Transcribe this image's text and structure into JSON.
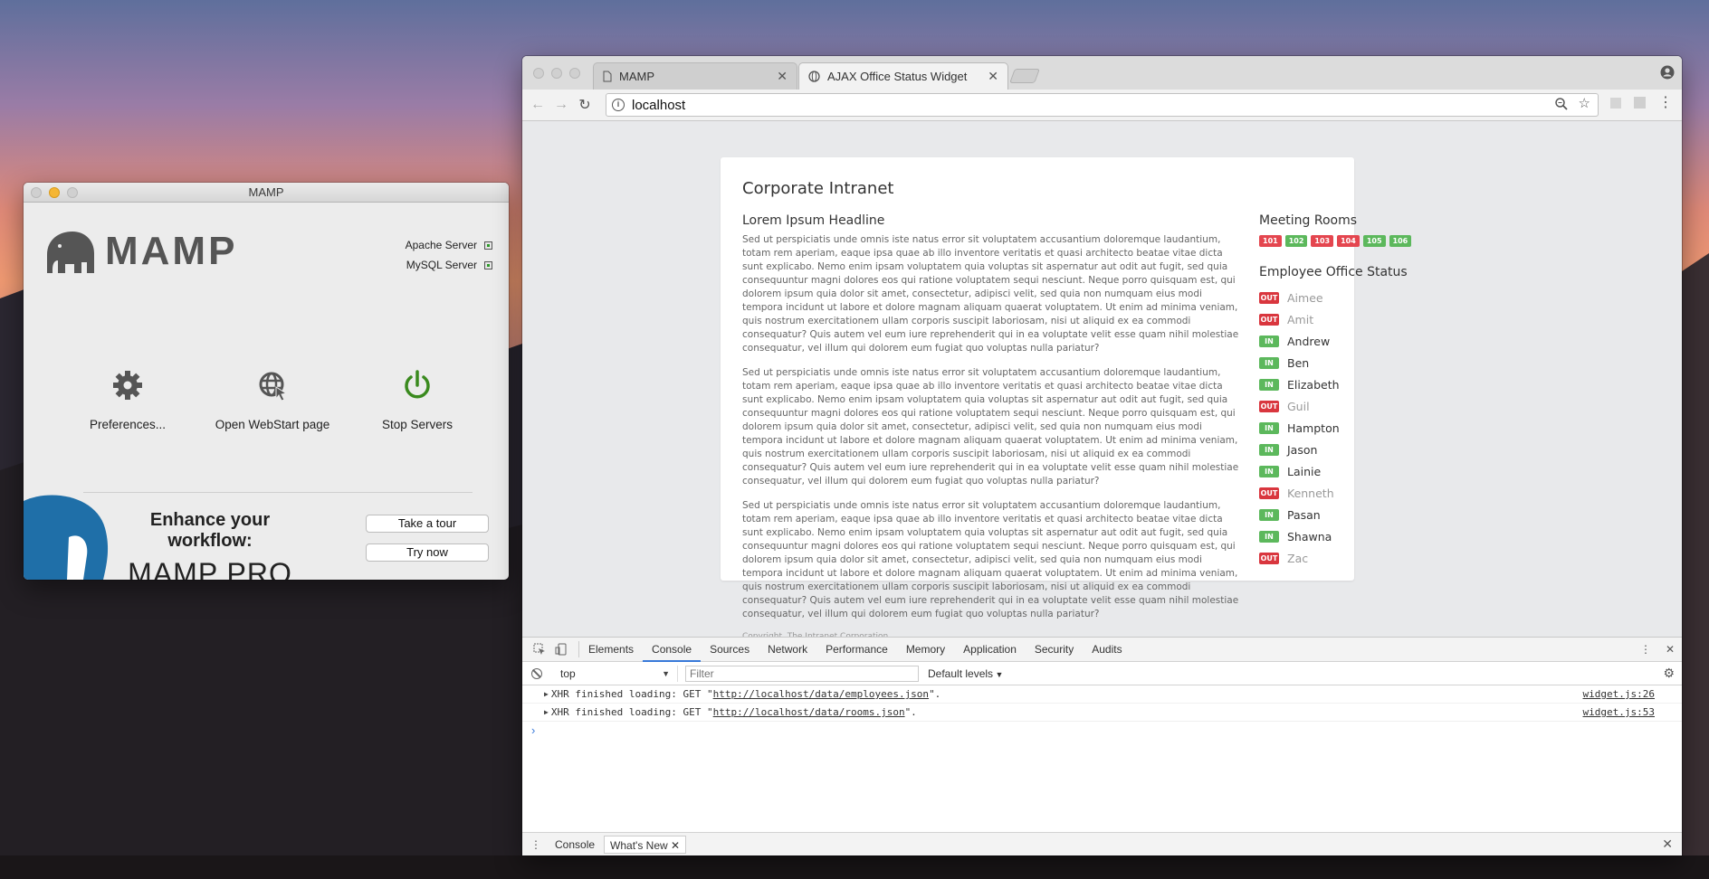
{
  "mamp": {
    "window_title": "MAMP",
    "logo_text": "MAMP",
    "servers": [
      {
        "label": "Apache Server"
      },
      {
        "label": "MySQL Server"
      }
    ],
    "actions": {
      "preferences": "Preferences...",
      "webstart": "Open WebStart page",
      "stop": "Stop Servers"
    },
    "promo": {
      "line1": "Enhance your workflow:",
      "line2": "MAMP PRO",
      "tour_button": "Take a tour",
      "try_button": "Try now"
    },
    "colors": {
      "stop_icon": "#3a8a1e",
      "accent": "#1f7ab8"
    }
  },
  "browser": {
    "tabs": [
      {
        "label": "MAMP",
        "icon": "document-icon"
      },
      {
        "label": "AJAX Office Status Widget",
        "icon": "globe-icon"
      }
    ],
    "url": "localhost"
  },
  "page": {
    "site_title": "Corporate Intranet",
    "article": {
      "headline": "Lorem Ipsum Headline",
      "paragraphs": [
        "Sed ut perspiciatis unde omnis iste natus error sit voluptatem accusantium doloremque laudantium, totam rem aperiam, eaque ipsa quae ab illo inventore veritatis et quasi architecto beatae vitae dicta sunt explicabo. Nemo enim ipsam voluptatem quia voluptas sit aspernatur aut odit aut fugit, sed quia consequuntur magni dolores eos qui ratione voluptatem sequi nesciunt. Neque porro quisquam est, qui dolorem ipsum quia dolor sit amet, consectetur, adipisci velit, sed quia non numquam eius modi tempora incidunt ut labore et dolore magnam aliquam quaerat voluptatem. Ut enim ad minima veniam, quis nostrum exercitationem ullam corporis suscipit laboriosam, nisi ut aliquid ex ea commodi consequatur? Quis autem vel eum iure reprehenderit qui in ea voluptate velit esse quam nihil molestiae consequatur, vel illum qui dolorem eum fugiat quo voluptas nulla pariatur?",
        "Sed ut perspiciatis unde omnis iste natus error sit voluptatem accusantium doloremque laudantium, totam rem aperiam, eaque ipsa quae ab illo inventore veritatis et quasi architecto beatae vitae dicta sunt explicabo. Nemo enim ipsam voluptatem quia voluptas sit aspernatur aut odit aut fugit, sed quia consequuntur magni dolores eos qui ratione voluptatem sequi nesciunt. Neque porro quisquam est, qui dolorem ipsum quia dolor sit amet, consectetur, adipisci velit, sed quia non numquam eius modi tempora incidunt ut labore et dolore magnam aliquam quaerat voluptatem. Ut enim ad minima veniam, quis nostrum exercitationem ullam corporis suscipit laboriosam, nisi ut aliquid ex ea commodi consequatur? Quis autem vel eum iure reprehenderit qui in ea voluptate velit esse quam nihil molestiae consequatur, vel illum qui dolorem eum fugiat quo voluptas nulla pariatur?",
        "Sed ut perspiciatis unde omnis iste natus error sit voluptatem accusantium doloremque laudantium, totam rem aperiam, eaque ipsa quae ab illo inventore veritatis et quasi architecto beatae vitae dicta sunt explicabo. Nemo enim ipsam voluptatem quia voluptas sit aspernatur aut odit aut fugit, sed quia consequuntur magni dolores eos qui ratione voluptatem sequi nesciunt. Neque porro quisquam est, qui dolorem ipsum quia dolor sit amet, consectetur, adipisci velit, sed quia non numquam eius modi tempora incidunt ut labore et dolore magnam aliquam quaerat voluptatem. Ut enim ad minima veniam, quis nostrum exercitationem ullam corporis suscipit laboriosam, nisi ut aliquid ex ea commodi consequatur? Quis autem vel eum iure reprehenderit qui in ea voluptate velit esse quam nihil molestiae consequatur, vel illum qui dolorem eum fugiat quo voluptas nulla pariatur?"
      ],
      "copyright": "Copyright, The Intranet Corporation"
    },
    "rooms_title": "Meeting Rooms",
    "rooms": [
      {
        "number": "101",
        "status": "red"
      },
      {
        "number": "102",
        "status": "green"
      },
      {
        "number": "103",
        "status": "red"
      },
      {
        "number": "104",
        "status": "red"
      },
      {
        "number": "105",
        "status": "green"
      },
      {
        "number": "106",
        "status": "green"
      }
    ],
    "employees_title": "Employee Office Status",
    "employees": [
      {
        "name": "Aimee",
        "status": "OUT"
      },
      {
        "name": "Amit",
        "status": "OUT"
      },
      {
        "name": "Andrew",
        "status": "IN"
      },
      {
        "name": "Ben",
        "status": "IN"
      },
      {
        "name": "Elizabeth",
        "status": "IN"
      },
      {
        "name": "Guil",
        "status": "OUT"
      },
      {
        "name": "Hampton",
        "status": "IN"
      },
      {
        "name": "Jason",
        "status": "IN"
      },
      {
        "name": "Lainie",
        "status": "IN"
      },
      {
        "name": "Kenneth",
        "status": "OUT"
      },
      {
        "name": "Pasan",
        "status": "IN"
      },
      {
        "name": "Shawna",
        "status": "IN"
      },
      {
        "name": "Zac",
        "status": "OUT"
      }
    ]
  },
  "devtools": {
    "tabs": [
      "Elements",
      "Console",
      "Sources",
      "Network",
      "Performance",
      "Memory",
      "Application",
      "Security",
      "Audits"
    ],
    "active_tab": "Console",
    "context": "top",
    "filter_placeholder": "Filter",
    "levels": "Default levels",
    "logs": [
      {
        "prefix": "XHR finished loading: GET \"",
        "url": "http://localhost/data/employees.json",
        "suffix": "\".",
        "source": "widget.js:26"
      },
      {
        "prefix": "XHR finished loading: GET \"",
        "url": "http://localhost/data/rooms.json",
        "suffix": "\".",
        "source": "widget.js:53"
      }
    ],
    "prompt": "›",
    "drawer_tabs": [
      "Console",
      "What's New"
    ]
  }
}
